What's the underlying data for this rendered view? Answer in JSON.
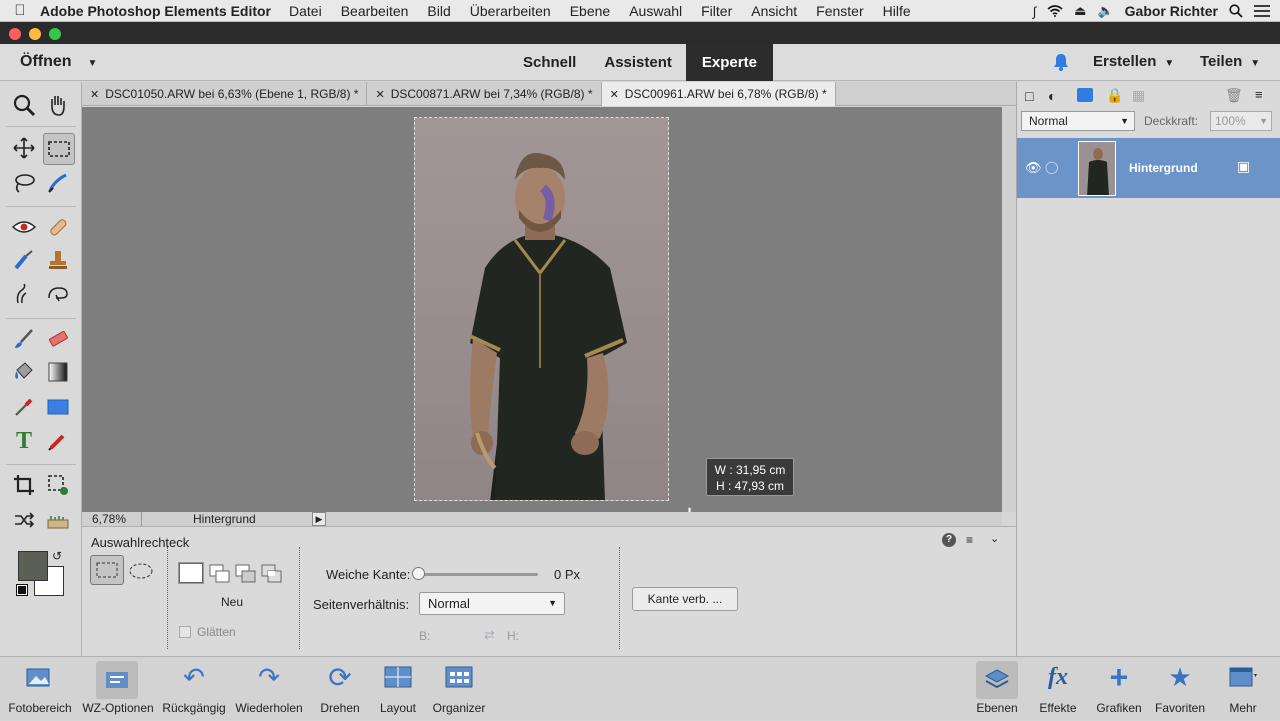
{
  "menubar": {
    "app_name": "Adobe Photoshop Elements Editor",
    "items": [
      "Datei",
      "Bearbeiten",
      "Bild",
      "Überarbeiten",
      "Ebene",
      "Auswahl",
      "Filter",
      "Ansicht",
      "Fenster",
      "Hilfe"
    ],
    "user": "Gabor Richter"
  },
  "header": {
    "open_label": "Öffnen",
    "modes": [
      "Schnell",
      "Assistent",
      "Experte"
    ],
    "active_mode": "Experte",
    "create_label": "Erstellen",
    "share_label": "Teilen"
  },
  "tabs": [
    {
      "label": "DSC01050.ARW bei 6,63% (Ebene 1, RGB/8) *"
    },
    {
      "label": "DSC00871.ARW bei 7,34% (RGB/8) *"
    },
    {
      "label": "DSC00961.ARW bei 6,78% (RGB/8) *"
    }
  ],
  "canvas": {
    "tooltip_w": "W : 31,95 cm",
    "tooltip_h": "H : 47,93 cm"
  },
  "statusbar": {
    "zoom": "6,78%",
    "layer": "Hintergrund"
  },
  "options": {
    "tool_name": "Auswahlrechteck",
    "mode_label": "Neu",
    "smooth_label": "Glätten",
    "feather_label": "Weiche Kante:",
    "feather_value": "0 Px",
    "aspect_label": "Seitenverhältnis:",
    "aspect_value": "Normal",
    "width_label": "B:",
    "height_label": "H:",
    "refine_label": "Kante verb. ..."
  },
  "layers_panel": {
    "blend_mode": "Normal",
    "opacity_label": "Deckkraft:",
    "opacity_value": "100%",
    "layer_name": "Hintergrund"
  },
  "bottombar": {
    "left": [
      "Fotobereich",
      "WZ-Optionen",
      "Rückgängig",
      "Wiederholen",
      "Drehen",
      "Layout",
      "Organizer"
    ],
    "right": [
      "Ebenen",
      "Effekte",
      "Grafiken",
      "Favoriten",
      "Mehr"
    ]
  },
  "colors": {
    "foreground": "#5b5f55",
    "background": "#ffffff",
    "accent": "#6d94c8"
  }
}
